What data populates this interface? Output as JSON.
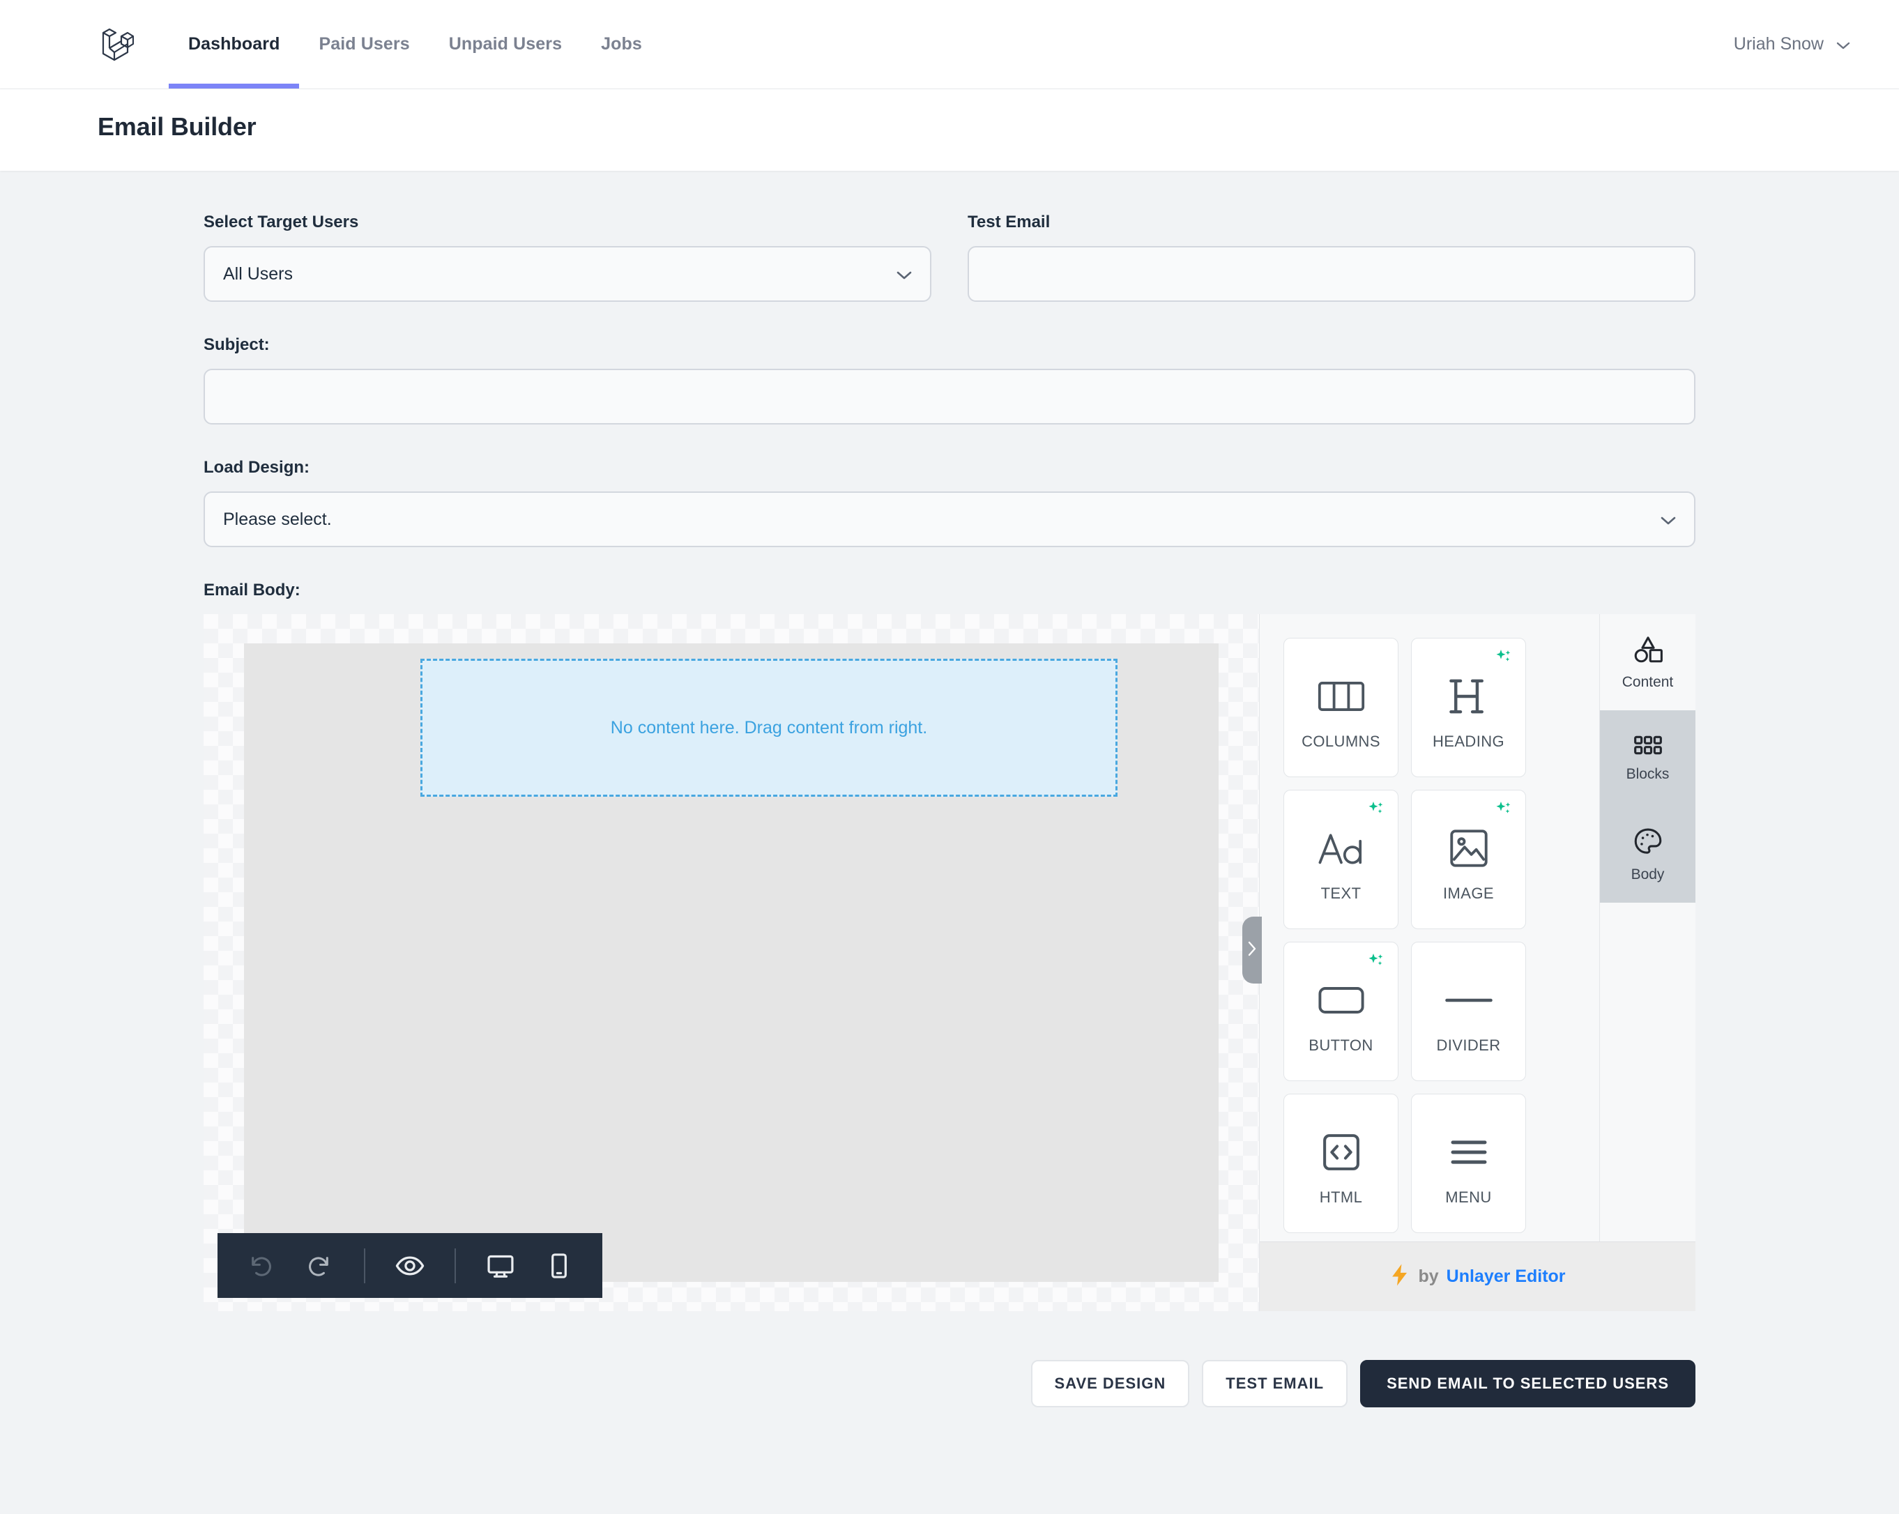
{
  "nav": {
    "brand_icon": "laravel-logo",
    "items": [
      {
        "label": "Dashboard",
        "active": true
      },
      {
        "label": "Paid Users",
        "active": false
      },
      {
        "label": "Unpaid Users",
        "active": false
      },
      {
        "label": "Jobs",
        "active": false
      }
    ],
    "user": {
      "name": "Uriah Snow",
      "chevron_icon": "chevron-down-icon"
    },
    "active_underline_color": "#7c84f7"
  },
  "page": {
    "title": "Email Builder"
  },
  "form": {
    "target_users": {
      "label": "Select Target Users",
      "value": "All Users",
      "chevron_icon": "chevron-down-icon"
    },
    "test_email": {
      "label": "Test Email",
      "value": "",
      "placeholder": ""
    },
    "subject": {
      "label": "Subject:",
      "value": "",
      "placeholder": ""
    },
    "load_design": {
      "label": "Load Design:",
      "value": "Please select.",
      "chevron_icon": "chevron-down-icon"
    },
    "email_body": {
      "label": "Email Body:"
    }
  },
  "editor": {
    "dropzone_text": "No content here. Drag content from right.",
    "dropzone_border_color": "#49a8e0",
    "dropzone_bg_color": "#ddeffa",
    "toolbar": [
      {
        "name": "undo-icon",
        "title": "Undo"
      },
      {
        "name": "redo-icon",
        "title": "Redo"
      },
      {
        "name": "preview-eye-icon",
        "title": "Preview"
      },
      {
        "name": "desktop-icon",
        "title": "Desktop view"
      },
      {
        "name": "mobile-icon",
        "title": "Mobile view"
      }
    ],
    "collapse_handle_icon": "chevron-right-icon",
    "tiles": [
      {
        "label": "COLUMNS",
        "icon": "columns-icon",
        "ai": false
      },
      {
        "label": "HEADING",
        "icon": "heading-icon",
        "ai": true
      },
      {
        "label": "TEXT",
        "icon": "text-aa-icon",
        "ai": true
      },
      {
        "label": "IMAGE",
        "icon": "image-icon",
        "ai": true
      },
      {
        "label": "BUTTON",
        "icon": "button-icon",
        "ai": true
      },
      {
        "label": "DIVIDER",
        "icon": "divider-icon",
        "ai": false
      },
      {
        "label": "HTML",
        "icon": "html-code-icon",
        "ai": false
      },
      {
        "label": "MENU",
        "icon": "menu-hamburger-icon",
        "ai": false
      }
    ],
    "rail_tabs": [
      {
        "label": "Content",
        "icon": "shapes-icon",
        "active": true
      },
      {
        "label": "Blocks",
        "icon": "grid-dots-icon",
        "active": false
      },
      {
        "label": "Body",
        "icon": "palette-icon",
        "active": false
      }
    ],
    "footer": {
      "bolt_icon": "lightning-bolt-icon",
      "by": "by",
      "brand": "Unlayer Editor",
      "brand_color": "#1d7efd"
    }
  },
  "actions": {
    "save_design": "SAVE DESIGN",
    "test_email": "TEST EMAIL",
    "send_email": "SEND EMAIL TO SELECTED USERS",
    "primary_color": "#212b3b"
  }
}
